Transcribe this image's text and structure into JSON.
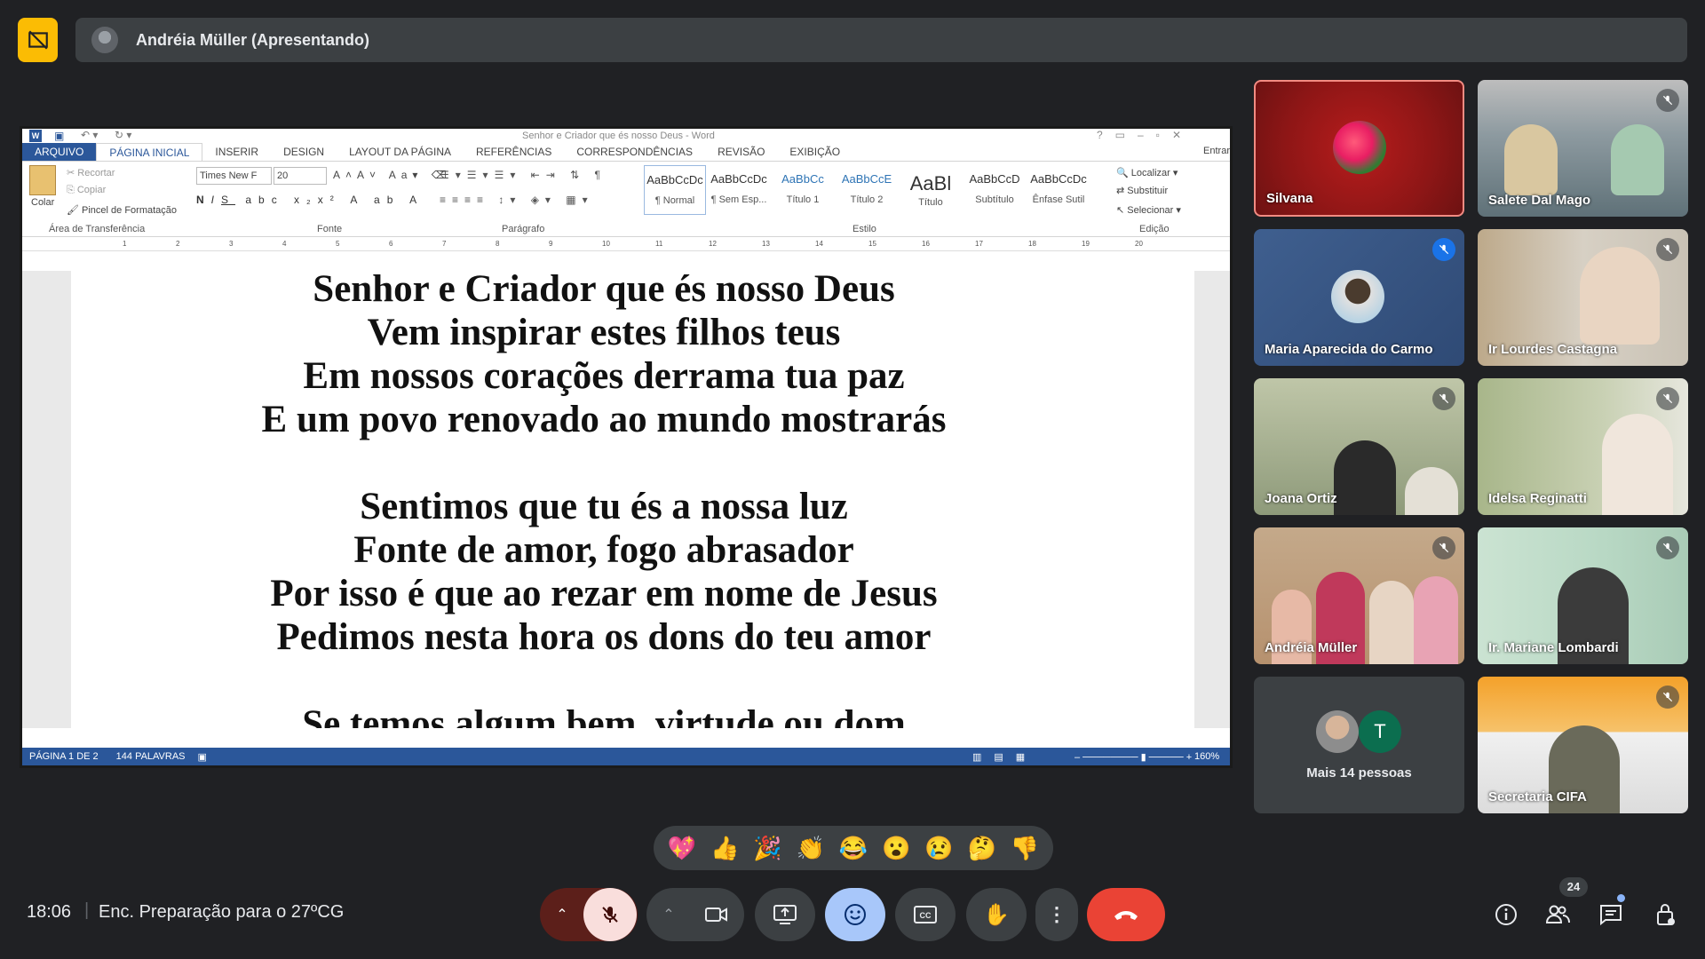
{
  "presenter": {
    "name": "Andréia Müller (Apresentando)"
  },
  "word": {
    "title": "Senhor e Criador que és nosso Deus - Word",
    "signin": "Entrar",
    "tabs": [
      "ARQUIVO",
      "PÁGINA INICIAL",
      "INSERIR",
      "DESIGN",
      "LAYOUT DA PÁGINA",
      "REFERÊNCIAS",
      "CORRESPONDÊNCIAS",
      "REVISÃO",
      "EXIBIÇÃO"
    ],
    "clipboard": {
      "paste": "Colar",
      "cut": "Recortar",
      "copy": "Copiar",
      "painter": "Pincel de Formatação",
      "label": "Área de Transferência"
    },
    "font": {
      "name": "Times New F",
      "size": "20",
      "label": "Fonte"
    },
    "paragraph_label": "Parágrafo",
    "styles": [
      {
        "preview": "AaBbCcDc",
        "name": "¶ Normal"
      },
      {
        "preview": "AaBbCcDc",
        "name": "¶ Sem Esp..."
      },
      {
        "preview": "AaBbCc",
        "name": "Título 1"
      },
      {
        "preview": "AaBbCcE",
        "name": "Título 2"
      },
      {
        "preview": "AaBl",
        "name": "Título"
      },
      {
        "preview": "AaBbCcD",
        "name": "Subtítulo"
      },
      {
        "preview": "AaBbCcDc",
        "name": "Ênfase Sutil"
      }
    ],
    "styles_label": "Estilo",
    "editing": {
      "find": "Localizar",
      "replace": "Substituir",
      "select": "Selecionar",
      "label": "Edição"
    },
    "ruler_numbers": [
      "1",
      "2",
      "3",
      "4",
      "5",
      "6",
      "7",
      "8",
      "9",
      "10",
      "11",
      "12",
      "13",
      "14",
      "15",
      "16",
      "17",
      "18",
      "19",
      "20"
    ],
    "lyrics": [
      "Senhor e Criador que és nosso Deus",
      "Vem inspirar estes filhos teus",
      "Em nossos corações derrama tua paz",
      "E um povo renovado ao mundo mostrarás",
      "",
      "Sentimos que tu és a nossa luz",
      "Fonte de amor, fogo abrasador",
      "Por isso é que ao rezar em nome de Jesus",
      "Pedimos nesta hora os dons do teu amor",
      "",
      "Se temos algum bem, virtude ou dom"
    ],
    "status": {
      "page": "PÁGINA 1 DE 2",
      "words": "144 PALAVRAS",
      "zoom": "160%"
    }
  },
  "participants": [
    {
      "name": "Silvana"
    },
    {
      "name": "Salete Dal Mago"
    },
    {
      "name": "Maria Aparecida do Carmo"
    },
    {
      "name": "Ir Lourdes Castagna"
    },
    {
      "name": "Joana Ortiz"
    },
    {
      "name": "Idelsa Reginatti"
    },
    {
      "name": "Andréia Müller"
    },
    {
      "name": "Ir. Mariane Lombardi"
    },
    {
      "name": "Mais 14 pessoas",
      "avatar_letter": "T"
    },
    {
      "name": "Secretaria CIFA"
    }
  ],
  "reactions": [
    "💖",
    "👍",
    "🎉",
    "👏",
    "😂",
    "😮",
    "😢",
    "🤔",
    "👎"
  ],
  "bottom": {
    "time": "18:06",
    "meeting_name": "Enc. Preparação para o 27ºCG",
    "people_count": "24"
  }
}
